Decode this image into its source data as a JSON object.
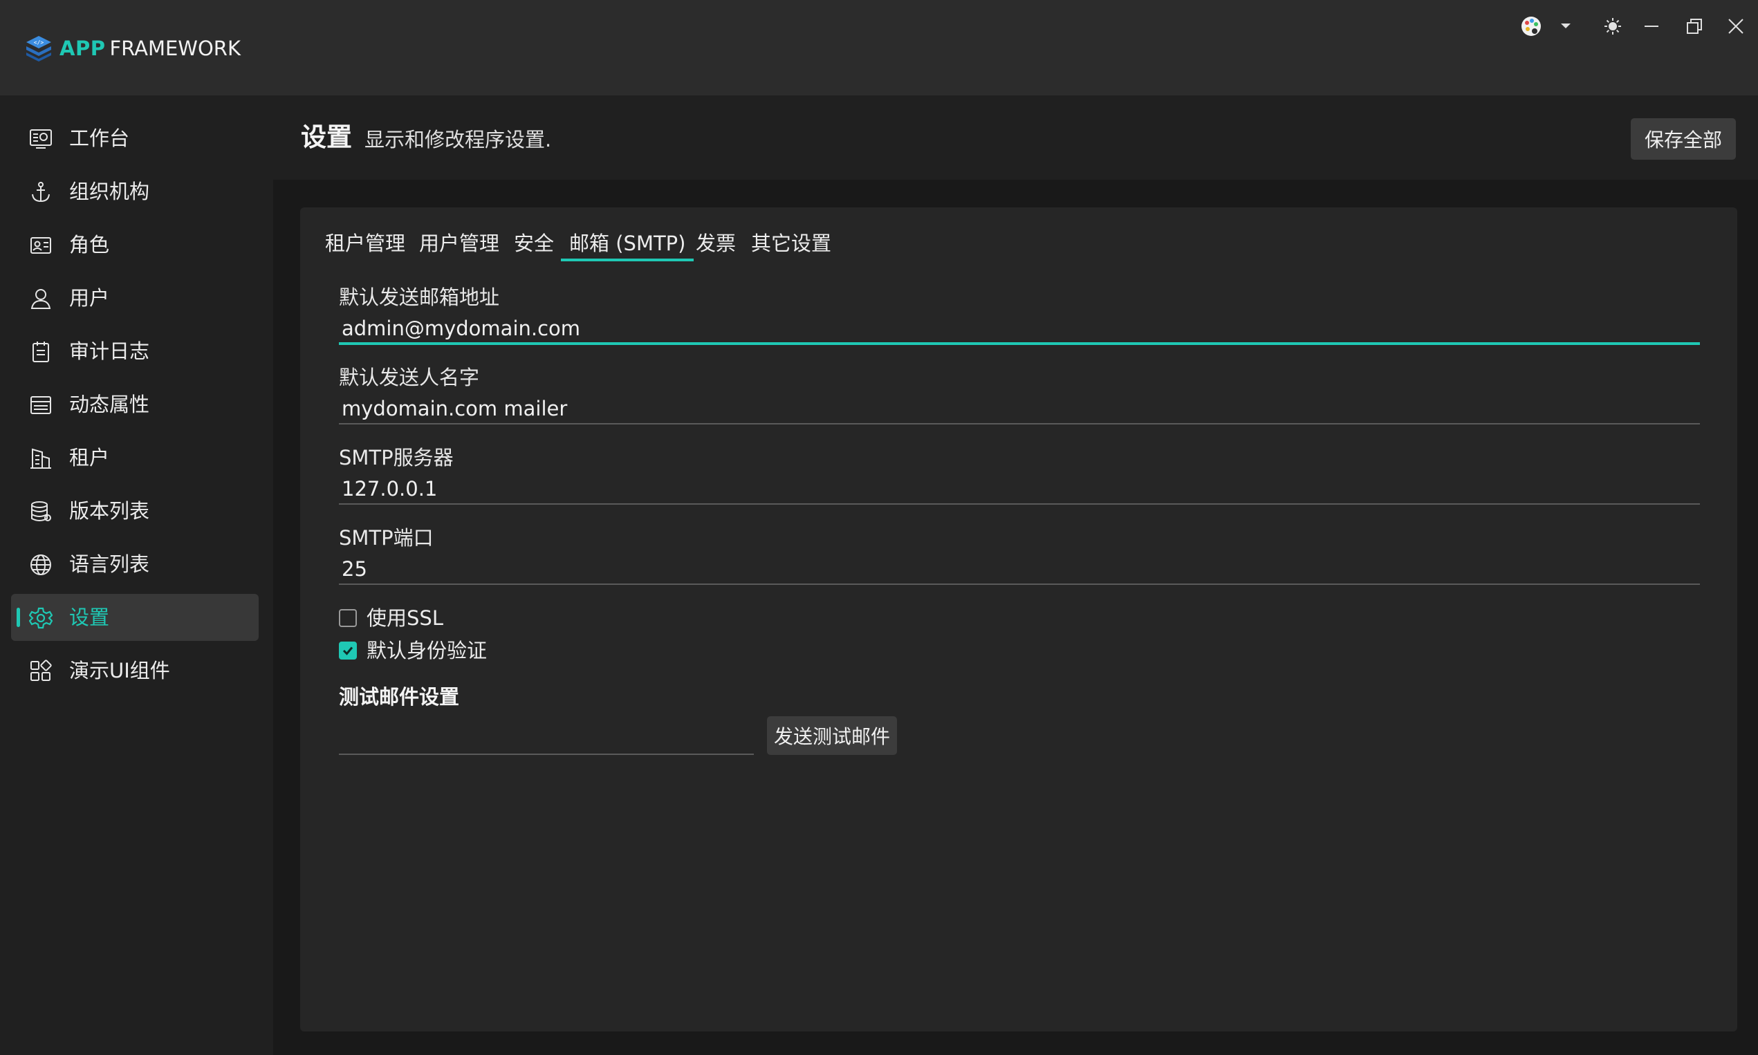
{
  "app": {
    "brand_app": "APP",
    "brand_framework": "FRAMEWORK",
    "accent": "#1fc8b4"
  },
  "window_controls": [
    "palette-icon",
    "chevron-down-icon",
    "sun-icon",
    "minimize-icon",
    "restore-icon",
    "close-icon"
  ],
  "sidebar": {
    "items": [
      {
        "label": "工作台",
        "icon": "dashboard-icon"
      },
      {
        "label": "组织机构",
        "icon": "anchor-icon"
      },
      {
        "label": "角色",
        "icon": "id-card-icon"
      },
      {
        "label": "用户",
        "icon": "user-icon"
      },
      {
        "label": "审计日志",
        "icon": "clipboard-icon"
      },
      {
        "label": "动态属性",
        "icon": "table-icon"
      },
      {
        "label": "租户",
        "icon": "building-icon"
      },
      {
        "label": "版本列表",
        "icon": "database-icon"
      },
      {
        "label": "语言列表",
        "icon": "globe-icon"
      },
      {
        "label": "设置",
        "icon": "gear-icon",
        "active": true
      },
      {
        "label": "演示UI组件",
        "icon": "apps-icon"
      }
    ]
  },
  "header": {
    "title": "设置",
    "subtitle": "显示和修改程序设置.",
    "save_all": "保存全部"
  },
  "tabs": [
    {
      "label": "租户管理"
    },
    {
      "label": "用户管理"
    },
    {
      "label": "安全"
    },
    {
      "label": "邮箱 (SMTP)",
      "active": true
    },
    {
      "label": "发票"
    },
    {
      "label": "其它设置"
    }
  ],
  "form": {
    "default_from_address": {
      "label": "默认发送邮箱地址",
      "value": "admin@mydomain.com"
    },
    "default_from_name": {
      "label": "默认发送人名字",
      "value": "mydomain.com mailer"
    },
    "smtp_host": {
      "label": "SMTP服务器",
      "value": "127.0.0.1"
    },
    "smtp_port": {
      "label": "SMTP端口",
      "value": "25"
    },
    "use_ssl": {
      "label": "使用SSL",
      "checked": false
    },
    "use_default_credentials": {
      "label": "默认身份验证",
      "checked": true
    }
  },
  "test_section": {
    "title": "测试邮件设置",
    "email_value": "",
    "send_button": "发送测试邮件"
  }
}
